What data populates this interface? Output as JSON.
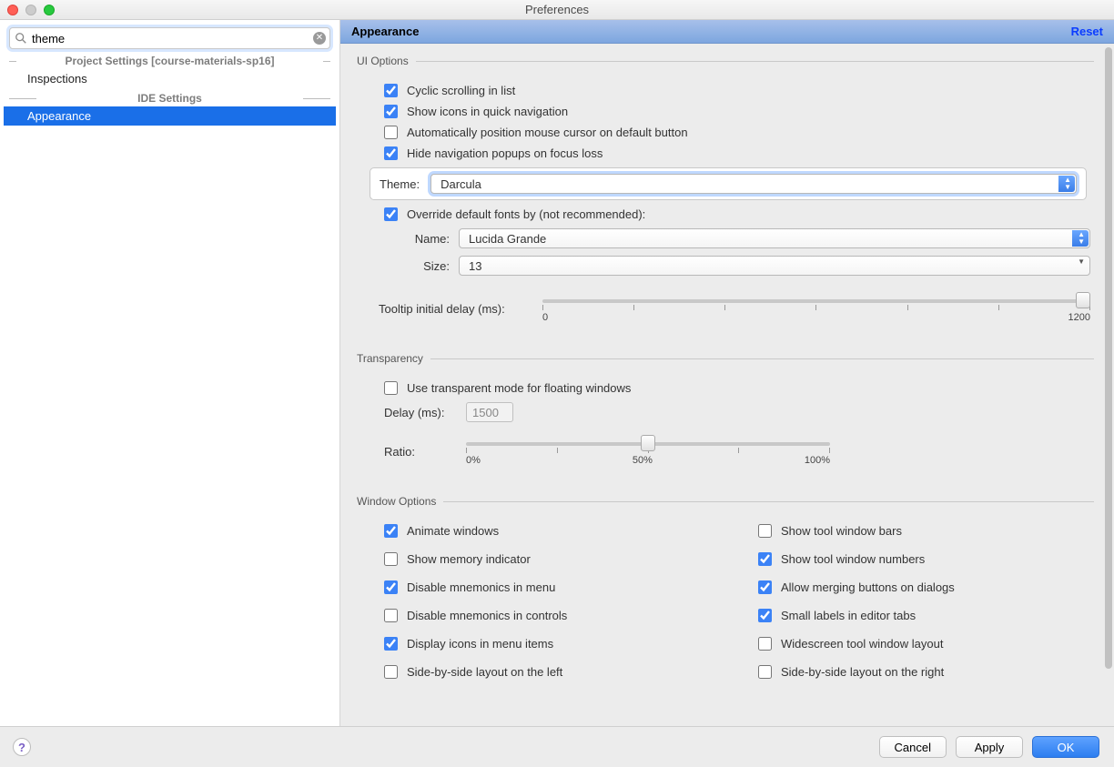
{
  "window": {
    "title": "Preferences"
  },
  "search": {
    "value": "theme"
  },
  "sidebar": {
    "heading1": "Project Settings [course-materials-sp16]",
    "heading2": "IDE Settings",
    "items": {
      "inspections": "Inspections",
      "appearance": "Appearance"
    }
  },
  "header": {
    "title": "Appearance",
    "reset": "Reset"
  },
  "groups": {
    "ui": {
      "legend": "UI Options",
      "cyclic": "Cyclic scrolling in list",
      "icons_nav": "Show icons in quick navigation",
      "auto_mouse": "Automatically position mouse cursor on default button",
      "hide_popups": "Hide navigation popups on focus loss",
      "theme_label": "Theme:",
      "theme_value": "Darcula",
      "override_fonts": "Override default fonts by (not recommended):",
      "name_label": "Name:",
      "name_value": "Lucida Grande",
      "size_label": "Size:",
      "size_value": "13",
      "tooltip_label": "Tooltip initial delay (ms):",
      "tooltip_min": "0",
      "tooltip_max": "1200"
    },
    "transparency": {
      "legend": "Transparency",
      "use_transparent": "Use transparent mode for floating windows",
      "delay_label": "Delay (ms):",
      "delay_value": "1500",
      "ratio_label": "Ratio:",
      "ratio_min": "0%",
      "ratio_mid": "50%",
      "ratio_max": "100%"
    },
    "window": {
      "legend": "Window Options",
      "animate": "Animate windows",
      "show_bars": "Show tool window bars",
      "memory": "Show memory indicator",
      "show_numbers": "Show tool window numbers",
      "disable_menu_mnemonics": "Disable mnemonics in menu",
      "allow_merging": "Allow merging buttons on dialogs",
      "disable_ctrl_mnemonics": "Disable mnemonics in controls",
      "small_labels": "Small labels in editor tabs",
      "icons_menu": "Display icons in menu items",
      "widescreen": "Widescreen tool window layout",
      "sbs_left": "Side-by-side layout on the left",
      "sbs_right": "Side-by-side layout on the right"
    }
  },
  "footer": {
    "cancel": "Cancel",
    "apply": "Apply",
    "ok": "OK"
  }
}
